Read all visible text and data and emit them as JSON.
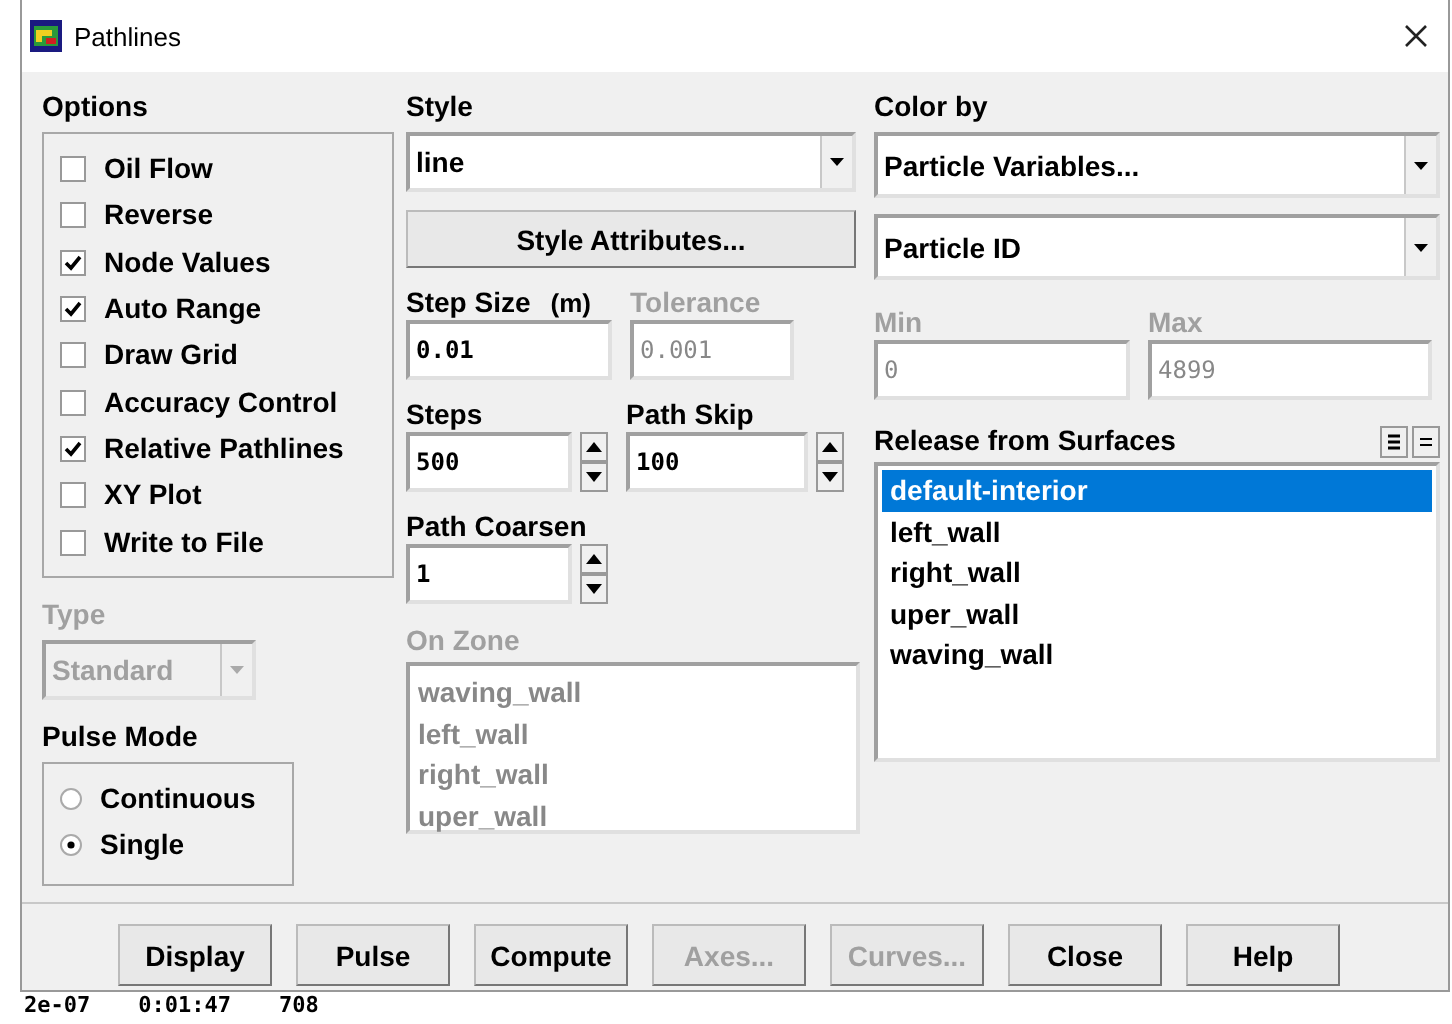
{
  "window": {
    "title": "Pathlines"
  },
  "options": {
    "label": "Options",
    "items": [
      {
        "label": "Oil Flow",
        "checked": false
      },
      {
        "label": "Reverse",
        "checked": false
      },
      {
        "label": "Node Values",
        "checked": true
      },
      {
        "label": "Auto Range",
        "checked": true
      },
      {
        "label": "Draw Grid",
        "checked": false
      },
      {
        "label": "Accuracy Control",
        "checked": false
      },
      {
        "label": "Relative Pathlines",
        "checked": true
      },
      {
        "label": "XY Plot",
        "checked": false
      },
      {
        "label": "Write to File",
        "checked": false
      }
    ]
  },
  "type": {
    "label": "Type",
    "value": "Standard",
    "disabled": true
  },
  "pulse_mode": {
    "label": "Pulse Mode",
    "options": [
      {
        "label": "Continuous",
        "selected": false
      },
      {
        "label": "Single",
        "selected": true
      }
    ]
  },
  "style": {
    "label": "Style",
    "value": "line"
  },
  "style_attributes_button": "Style Attributes...",
  "step_size": {
    "label": "Step Size",
    "unit": "(m)",
    "value": "0.01"
  },
  "tolerance": {
    "label": "Tolerance",
    "value": "0.001",
    "disabled": true
  },
  "steps": {
    "label": "Steps",
    "value": "500"
  },
  "path_skip": {
    "label": "Path Skip",
    "value": "100"
  },
  "path_coarsen": {
    "label": "Path Coarsen",
    "value": "1"
  },
  "on_zone": {
    "label": "On Zone",
    "disabled": true,
    "items": [
      "waving_wall",
      "left_wall",
      "right_wall",
      "uper_wall"
    ]
  },
  "color_by": {
    "label": "Color by",
    "value": "Particle Variables...",
    "sub_value": "Particle ID"
  },
  "min": {
    "label": "Min",
    "value": "0",
    "disabled": true
  },
  "max": {
    "label": "Max",
    "value": "4899",
    "disabled": true
  },
  "release_from_surfaces": {
    "label": "Release from Surfaces",
    "items": [
      {
        "label": "default-interior",
        "selected": true
      },
      {
        "label": "left_wall",
        "selected": false
      },
      {
        "label": "right_wall",
        "selected": false
      },
      {
        "label": "uper_wall",
        "selected": false
      },
      {
        "label": "waving_wall",
        "selected": false
      }
    ]
  },
  "buttons": [
    {
      "label": "Display",
      "disabled": false
    },
    {
      "label": "Pulse",
      "disabled": false
    },
    {
      "label": "Compute",
      "disabled": false
    },
    {
      "label": "Axes...",
      "disabled": true
    },
    {
      "label": "Curves...",
      "disabled": true
    },
    {
      "label": "Close",
      "disabled": false
    },
    {
      "label": "Help",
      "disabled": false
    }
  ],
  "background_console": [
    "2e-07",
    "0:01:47",
    "708"
  ]
}
